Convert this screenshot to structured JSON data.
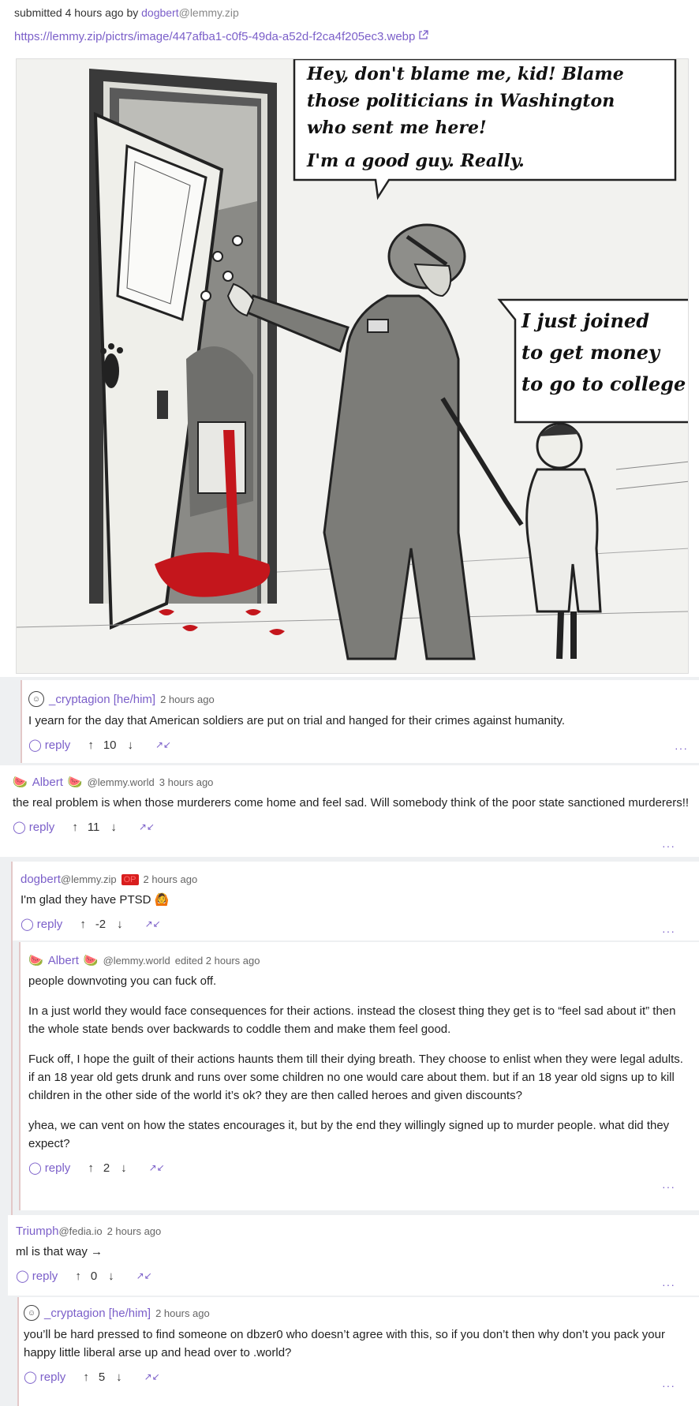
{
  "post": {
    "submitted_prefix": "submitted",
    "time": "4 hours ago",
    "by": "by",
    "author": "dogbert",
    "author_instance": "@lemmy.zip",
    "link": "https://lemmy.zip/pictrs/image/447afba1-c0f5-49da-a52d-f2ca4f205ec3.webp",
    "cartoon": {
      "bubble1_line1": "Hey, don't blame me, kid! Blame",
      "bubble1_line2": "those politicians in Washington",
      "bubble1_line3": "who sent me here!",
      "bubble1_line4": "I'm a good guy. Really.",
      "bubble2_line1": "I just joined",
      "bubble2_line2": "to get money",
      "bubble2_line3": "to go to college"
    }
  },
  "labels": {
    "reply": "reply",
    "up": "↑",
    "down": "↓",
    "collapse": "↗↙",
    "more": "···"
  },
  "comments": [
    {
      "user": "_cryptagion [he/him]",
      "time": "2 hours ago",
      "text": "I yearn for the day that American soldiers are put on trial and hanged for their crimes against humanity.",
      "score": "10"
    },
    {
      "user": "Albert",
      "instance": "@lemmy.world",
      "time": "3 hours ago",
      "text": "the real problem is when those murderers come home and feel sad. Will somebody think of the poor state sanctioned murderers!!",
      "score": "11"
    },
    {
      "user": "dogbert",
      "instance": "@lemmy.zip",
      "badge": "OP",
      "time": "2 hours ago",
      "text": "I'm glad they have PTSD 🙆",
      "score": "-2"
    },
    {
      "user": "Albert",
      "instance": "@lemmy.world",
      "time": "edited 2 hours ago",
      "p1": "people downvoting you can fuck off.",
      "p2": "In a just world they would face consequences for their actions. instead the closest thing they get is to “feel sad about it” then the whole state bends over backwards to coddle them and make them feel good.",
      "p3": "Fuck off, I hope the guilt of their actions haunts them till their dying breath. They choose to enlist when they were legal adults. if an 18 year old gets drunk and runs over some children no one would care about them. but if an 18 year old signs up to kill children in the other side of the world it’s ok? they are then called heroes and given discounts?",
      "p4": "yhea, we can vent on how the states encourages it, but by the end they willingly signed up to murder people. what did they expect?",
      "score": "2"
    },
    {
      "user": "Triumph",
      "instance": "@fedia.io",
      "time": "2 hours ago",
      "text": "ml is that way →",
      "score": "0"
    },
    {
      "user": "_cryptagion [he/him]",
      "time": "2 hours ago",
      "text": "you’ll be hard pressed to find someone on dbzer0 who doesn’t agree with this, so if you don’t then why don’t you pack your happy little liberal arse up and head over to .world?",
      "score": "5"
    }
  ],
  "colors": {
    "accent": "#7b5fc9",
    "op_badge": "#d81e1e",
    "blood": "#c4161c"
  },
  "icons": [
    "reply-icon",
    "upvote-icon",
    "downvote-icon",
    "collapse-icon",
    "more-icon",
    "external-link-icon",
    "watermelon-icon",
    "avatar-icon"
  ]
}
